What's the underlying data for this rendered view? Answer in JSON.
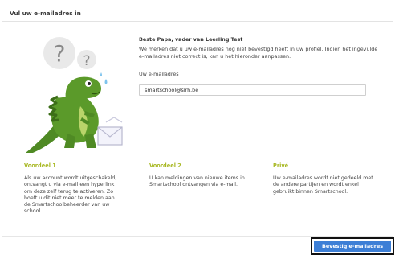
{
  "dialog": {
    "title": "Vul uw e-mailadres in"
  },
  "intro": {
    "greeting": "Beste Papa, vader van Leerling Test",
    "text": "We merken dat u uw e-mailadres nog niet bevestigd heeft in uw profiel. Indien het ingevulde e-mailadres niet correct is, kan u het hieronder aanpassen."
  },
  "email": {
    "label": "Uw e-mailadres",
    "value": "smartschool@sirh.be"
  },
  "illustration": {
    "icons": [
      "question-mark-bubble-icon",
      "question-mark-bubble-icon",
      "dinosaur-mascot-icon",
      "envelope-icon"
    ],
    "question_mark": "?"
  },
  "benefits": [
    {
      "title": "Voordeel 1",
      "text": "Als uw account wordt uitgeschakeld, ontvangt u via e-mail een hyperlink om deze zelf terug te activeren. Zo hoeft u dit niet meer te melden aan de Smartschoolbeheerder van uw school."
    },
    {
      "title": "Voordeel 2",
      "text": "U kan meldingen van nieuwe items in Smartschool ontvangen via e-mail."
    },
    {
      "title": "Privé",
      "text": "Uw e-mailadres wordt niet gedeeld met de andere partijen en wordt enkel gebruikt binnen Smartschool."
    }
  ],
  "actions": {
    "confirm_label": "Bevestig e-mailadres"
  },
  "colors": {
    "accent_green": "#a8b823",
    "button_blue": "#3d7fd6",
    "dino_green": "#5b9a2a"
  }
}
